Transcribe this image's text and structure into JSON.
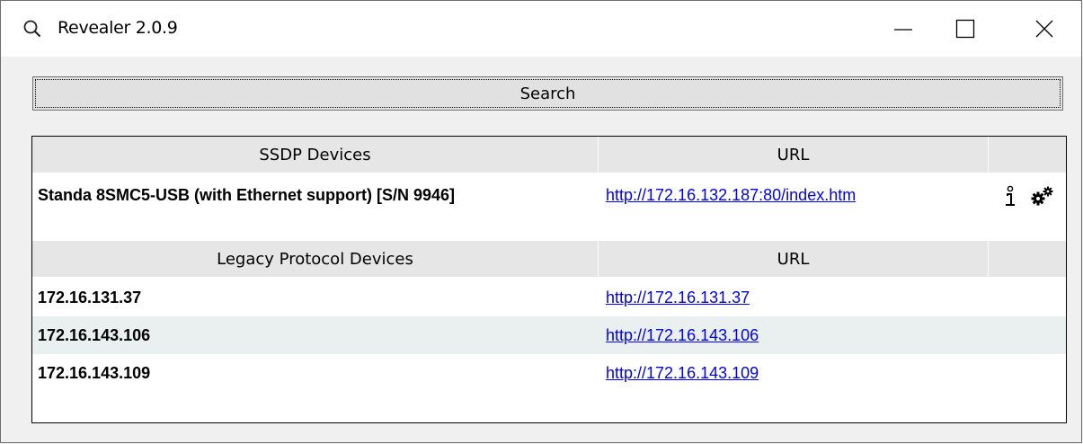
{
  "window": {
    "title": "Revealer 2.0.9"
  },
  "toolbar": {
    "search_label": "Search"
  },
  "ssdp": {
    "headers": [
      "SSDP Devices",
      "URL",
      ""
    ],
    "rows": [
      {
        "name": "Standa 8SMC5-USB (with Ethernet support) [S/N 9946]",
        "url": "http://172.16.132.187:80/index.htm",
        "icons": [
          "info-icon",
          "settings-gears-icon"
        ]
      }
    ]
  },
  "legacy": {
    "headers": [
      "Legacy Protocol Devices",
      "URL",
      ""
    ],
    "rows": [
      {
        "name": "172.16.131.37",
        "url": "http://172.16.131.37"
      },
      {
        "name": "172.16.143.106",
        "url": "http://172.16.143.106"
      },
      {
        "name": "172.16.143.109",
        "url": "http://172.16.143.109"
      }
    ]
  },
  "colors": {
    "link": "#0000ee",
    "header_bg": "#e6e6e6",
    "alt_row_bg": "#eaf0f0",
    "window_bg": "#f0f0f0"
  }
}
